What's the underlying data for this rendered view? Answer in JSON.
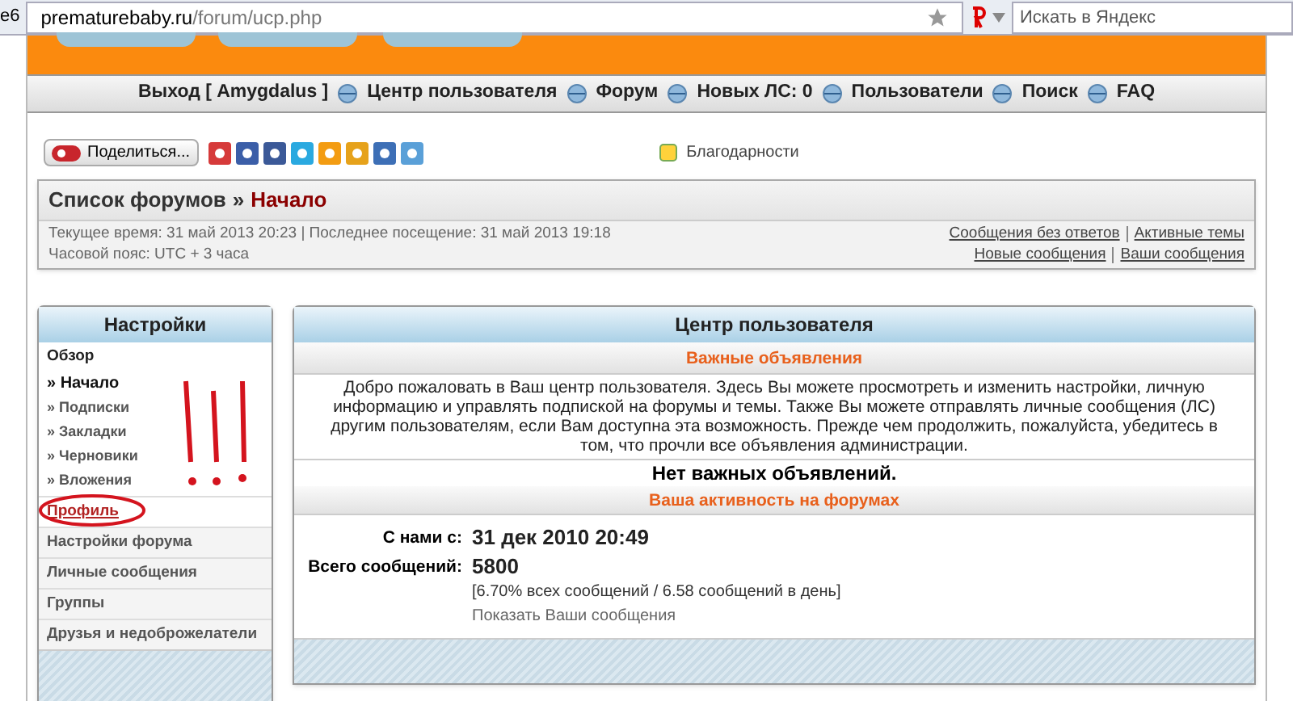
{
  "browser": {
    "tab_fragment": "е6",
    "url_host": "prematurebaby.ru",
    "url_path": "/forum/ucp.php",
    "search_placeholder": "Искать в Яндекс"
  },
  "nav": [
    "Выход [ Amygdalus ]",
    "Центр пользователя",
    "Форум",
    "Новых ЛС: 0",
    "Пользователи",
    "Поиск",
    "FAQ"
  ],
  "share": {
    "button": "Поделиться...",
    "thanks": "Благодарности"
  },
  "breadcrumb": {
    "root": "Список форумов",
    "separator": "»",
    "current": "Начало"
  },
  "info": {
    "current_time": "Текущее время: 31 май 2013 20:23 | Последнее посещение: 31 май 2013 19:18",
    "timezone": "Часовой пояс: UTC + 3 часа",
    "links": [
      [
        "Сообщения без ответов",
        "Активные темы"
      ],
      [
        "Новые сообщения",
        "Ваши сообщения"
      ]
    ]
  },
  "sidebar": {
    "title": "Настройки",
    "items": [
      {
        "label": "Обзор",
        "hovered": false,
        "children": [
          {
            "label": "» Начало",
            "selected": true
          },
          {
            "label": "» Подписки",
            "selected": false
          },
          {
            "label": "» Закладки",
            "selected": false
          },
          {
            "label": "» Черновики",
            "selected": false
          },
          {
            "label": "» Вложения",
            "selected": false
          }
        ]
      },
      {
        "label": "Профиль",
        "hovered": true
      },
      {
        "label": "Настройки форума",
        "hovered": false
      },
      {
        "label": "Личные сообщения",
        "hovered": false
      },
      {
        "label": "Группы",
        "hovered": false
      },
      {
        "label": "Друзья и недоброжелатели",
        "hovered": false
      }
    ]
  },
  "panel": {
    "title": "Центр пользователя",
    "announcements_heading": "Важные объявления",
    "welcome": "Добро пожаловать в Ваш центр пользователя. Здесь Вы можете просмотреть и изменить настройки, личную информацию и управлять подпиской на форумы и темы. Также Вы можете отправлять личные сообщения (ЛС) другим пользователям, если Вам доступна эта возможность. Прежде чем продолжить, пожалуйста, убедитесь в том, что прочли все объявления администрации.",
    "no_announcements": "Нет важных объявлений.",
    "activity_heading": "Ваша активность на форумах",
    "stats": [
      {
        "label": "С нами с:",
        "value": "31 дек 2010 20:49"
      },
      {
        "label": "Всего сообщений:",
        "value": "5800",
        "note": "[6.70% всех сообщений / 6.58 сообщений в день]",
        "link": "Показать Ваши сообщения"
      }
    ]
  }
}
